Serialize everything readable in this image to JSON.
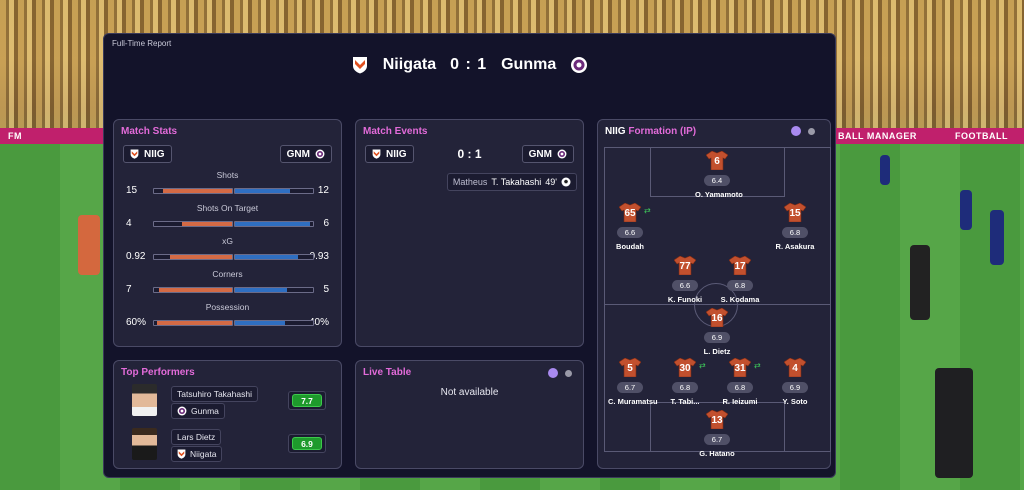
{
  "report": {
    "title": "Full-Time Report",
    "home_team": "Niigata",
    "away_team": "Gunma",
    "score": "0 : 1"
  },
  "match_stats": {
    "title": "Match Stats",
    "home_abbr": "NIIG",
    "away_abbr": "GNM",
    "rows": [
      {
        "label": "Shots",
        "home": "15",
        "away": "12",
        "home_frac": 0.556,
        "away_frac": 0.444
      },
      {
        "label": "Shots On Target",
        "home": "4",
        "away": "6",
        "home_frac": 0.4,
        "away_frac": 0.6
      },
      {
        "label": "xG",
        "home": "0.92",
        "away": "0.93",
        "home_frac": 0.497,
        "away_frac": 0.503
      },
      {
        "label": "Corners",
        "home": "7",
        "away": "5",
        "home_frac": 0.583,
        "away_frac": 0.417
      },
      {
        "label": "Possession",
        "home": "60%",
        "away": "40%",
        "home_frac": 0.6,
        "away_frac": 0.4
      }
    ]
  },
  "match_events": {
    "title": "Match Events",
    "home_abbr": "NIIG",
    "away_abbr": "GNM",
    "score": "0 : 1",
    "events": [
      {
        "assist": "Matheus",
        "scorer": "T. Takahashi",
        "minute": "49'",
        "icon": "football-icon"
      }
    ]
  },
  "formation": {
    "title_team": "NIIG",
    "title_rest": "Formation (IP)",
    "players": [
      {
        "number": "6",
        "rating": "6.4",
        "name": "O. Yamamoto"
      },
      {
        "number": "65",
        "rating": "6.6",
        "name": "Boudah",
        "sub": true
      },
      {
        "number": "15",
        "rating": "6.8",
        "name": "R. Asakura"
      },
      {
        "number": "77",
        "rating": "6.6",
        "name": "K. Funoki"
      },
      {
        "number": "17",
        "rating": "6.8",
        "name": "S. Kodama"
      },
      {
        "number": "16",
        "rating": "6.9",
        "name": "L. Dietz"
      },
      {
        "number": "5",
        "rating": "6.7",
        "name": "C. Muramatsu"
      },
      {
        "number": "30",
        "rating": "6.8",
        "name": "T. Tabi...",
        "sub": true
      },
      {
        "number": "31",
        "rating": "6.8",
        "name": "R. Ieizumi",
        "sub": true
      },
      {
        "number": "4",
        "rating": "6.9",
        "name": "Y. Soto"
      },
      {
        "number": "13",
        "rating": "6.7",
        "name": "G. Hatano"
      }
    ]
  },
  "top_performers": {
    "title": "Top Performers",
    "players": [
      {
        "name": "Tatsuhiro Takahashi",
        "team": "Gunma",
        "rating": "7.7"
      },
      {
        "name": "Lars Dietz",
        "team": "Niigata",
        "rating": "6.9"
      }
    ]
  },
  "live_table": {
    "title": "Live Table",
    "message": "Not available"
  },
  "background": {
    "board_texts": [
      "FM",
      "BALL MANAGER",
      "FOOTBALL"
    ]
  },
  "colors": {
    "accent_title": "#e26bd9",
    "home_bar": "#d46a45",
    "away_bar": "#2f6fc2",
    "rating_good": "#1e9a2c",
    "panel": "#13132a"
  }
}
